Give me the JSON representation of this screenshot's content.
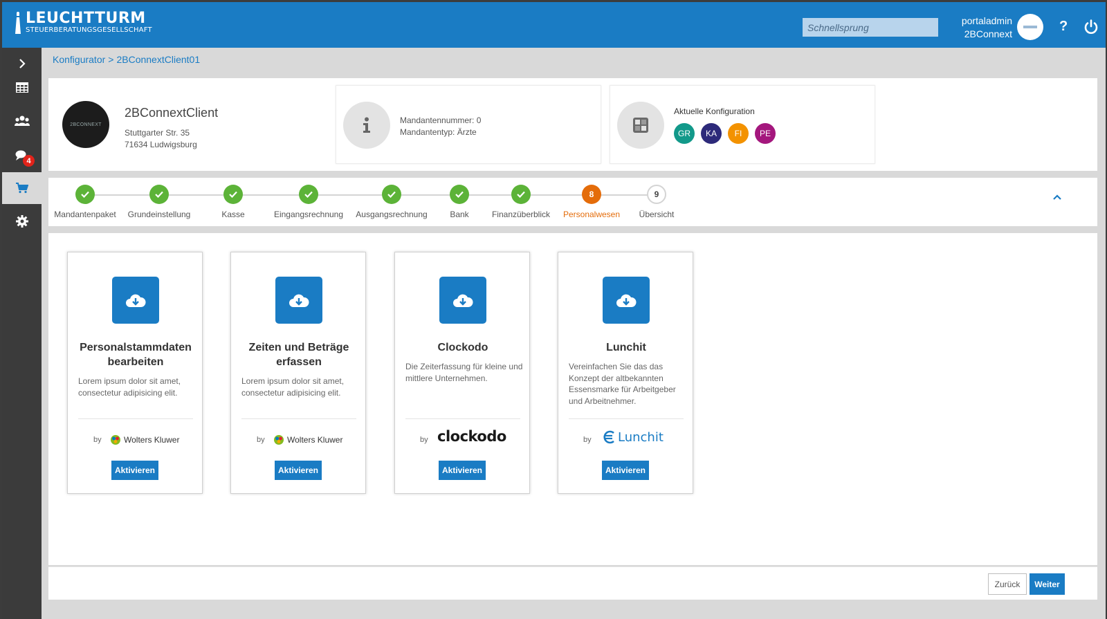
{
  "header": {
    "brand": "LEUCHTTURM",
    "brand_sub": "STEUERBERATUNGSGESELLSCHAFT",
    "search_placeholder": "Schnellsprung",
    "user_name": "portaladmin",
    "user_org": "2BConnext",
    "help_label": "?"
  },
  "sidebar": {
    "items": [
      {
        "icon": "chevron-right-icon"
      },
      {
        "icon": "table-icon"
      },
      {
        "icon": "users-icon"
      },
      {
        "icon": "notifications-icon",
        "badge": "4"
      },
      {
        "icon": "cart-icon",
        "active": true
      },
      {
        "icon": "gear-icon"
      }
    ]
  },
  "breadcrumb": {
    "root": "Konfigurator",
    "separator": ">",
    "current": "2BConnextClient01"
  },
  "client": {
    "logo_text": "2BCONNEXT",
    "name": "2BConnextClient",
    "street": "Stuttgarter Str. 35",
    "city": "71634 Ludwigsburg",
    "mandant_number": "Mandantennummer: 0",
    "mandant_type": "Mandantentyp: Ärzte",
    "config_title": "Aktuelle Konfiguration",
    "chips": [
      {
        "label": "GR",
        "color": "#12998a"
      },
      {
        "label": "KA",
        "color": "#2d2a7a"
      },
      {
        "label": "FI",
        "color": "#f39200"
      },
      {
        "label": "PE",
        "color": "#a4177d"
      }
    ]
  },
  "stepper": {
    "steps": [
      {
        "label": "Mandantenpaket",
        "state": "done"
      },
      {
        "label": "Grundeinstellung",
        "state": "done"
      },
      {
        "label": "Kasse",
        "state": "done"
      },
      {
        "label": "Eingangsrechnung",
        "state": "done"
      },
      {
        "label": "Ausgangsrechnung",
        "state": "done"
      },
      {
        "label": "Bank",
        "state": "done"
      },
      {
        "label": "Finanzüberblick",
        "state": "done"
      },
      {
        "label": "Personalwesen",
        "state": "current",
        "number": "8"
      },
      {
        "label": "Übersicht",
        "state": "todo",
        "number": "9"
      }
    ]
  },
  "cards": [
    {
      "title_line1": "Personalstammdaten",
      "title_line2": "bearbeiten",
      "description": "Lorem ipsum dolor sit amet, consectetur adipisicing elit.",
      "by": "by",
      "vendor": "Wolters Kluwer",
      "button": "Aktivieren"
    },
    {
      "title_line1": "Zeiten und Beträge",
      "title_line2": "erfassen",
      "description": "Lorem ipsum dolor sit amet, consectetur adipisicing elit.",
      "by": "by",
      "vendor": "Wolters Kluwer",
      "button": "Aktivieren"
    },
    {
      "title_line1": "Clockodo",
      "title_line2": "",
      "description": "Die Zeiterfassung für kleine und mittlere Unternehmen.",
      "by": "by",
      "vendor": "clockodo",
      "button": "Aktivieren"
    },
    {
      "title_line1": "Lunchit",
      "title_line2": "",
      "description": "Vereinfachen Sie das das Konzept der altbekannten Essensmarke für Arbeitgeber und Arbeitnehmer.",
      "by": "by",
      "vendor": "Lunchit",
      "button": "Aktivieren"
    }
  ],
  "footer": {
    "back": "Zurück",
    "next": "Weiter"
  },
  "colors": {
    "primary": "#1a7cc4",
    "done": "#5cb338",
    "current": "#e46c0a"
  }
}
